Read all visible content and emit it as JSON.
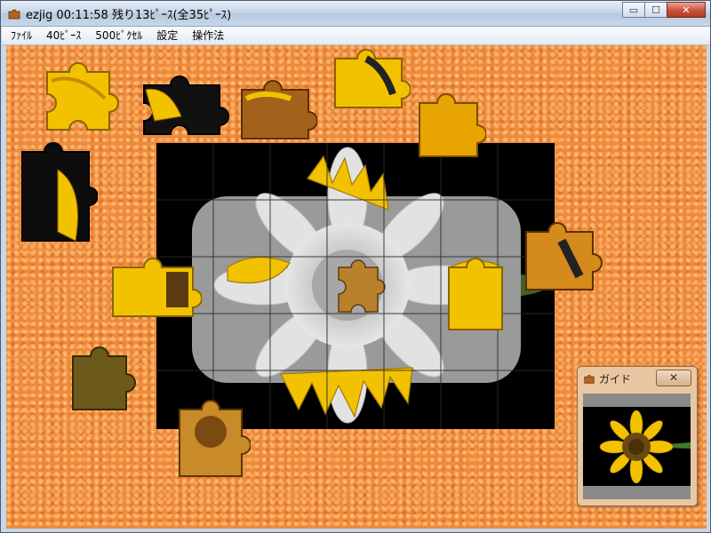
{
  "window": {
    "title": "ezjig 00:11:58 残り13ﾋﾟｰｽ(全35ﾋﾟｰｽ)",
    "controls": {
      "minimize": "▭",
      "maximize": "☐",
      "close": "✕"
    }
  },
  "menu": {
    "items": [
      "ﾌｧｲﾙ",
      "40ﾋﾟｰｽ",
      "500ﾋﾟｸｾﾙ",
      "設定",
      "操作法"
    ]
  },
  "guide": {
    "title": "ガイド",
    "close_label": "✕"
  },
  "colors": {
    "board_orange": "#f08a3a",
    "petal_yellow": "#f2c200",
    "seed_brown": "#8a5a1a"
  },
  "icons": {
    "app": "puzzle-piece-icon",
    "guide": "puzzle-piece-icon"
  }
}
